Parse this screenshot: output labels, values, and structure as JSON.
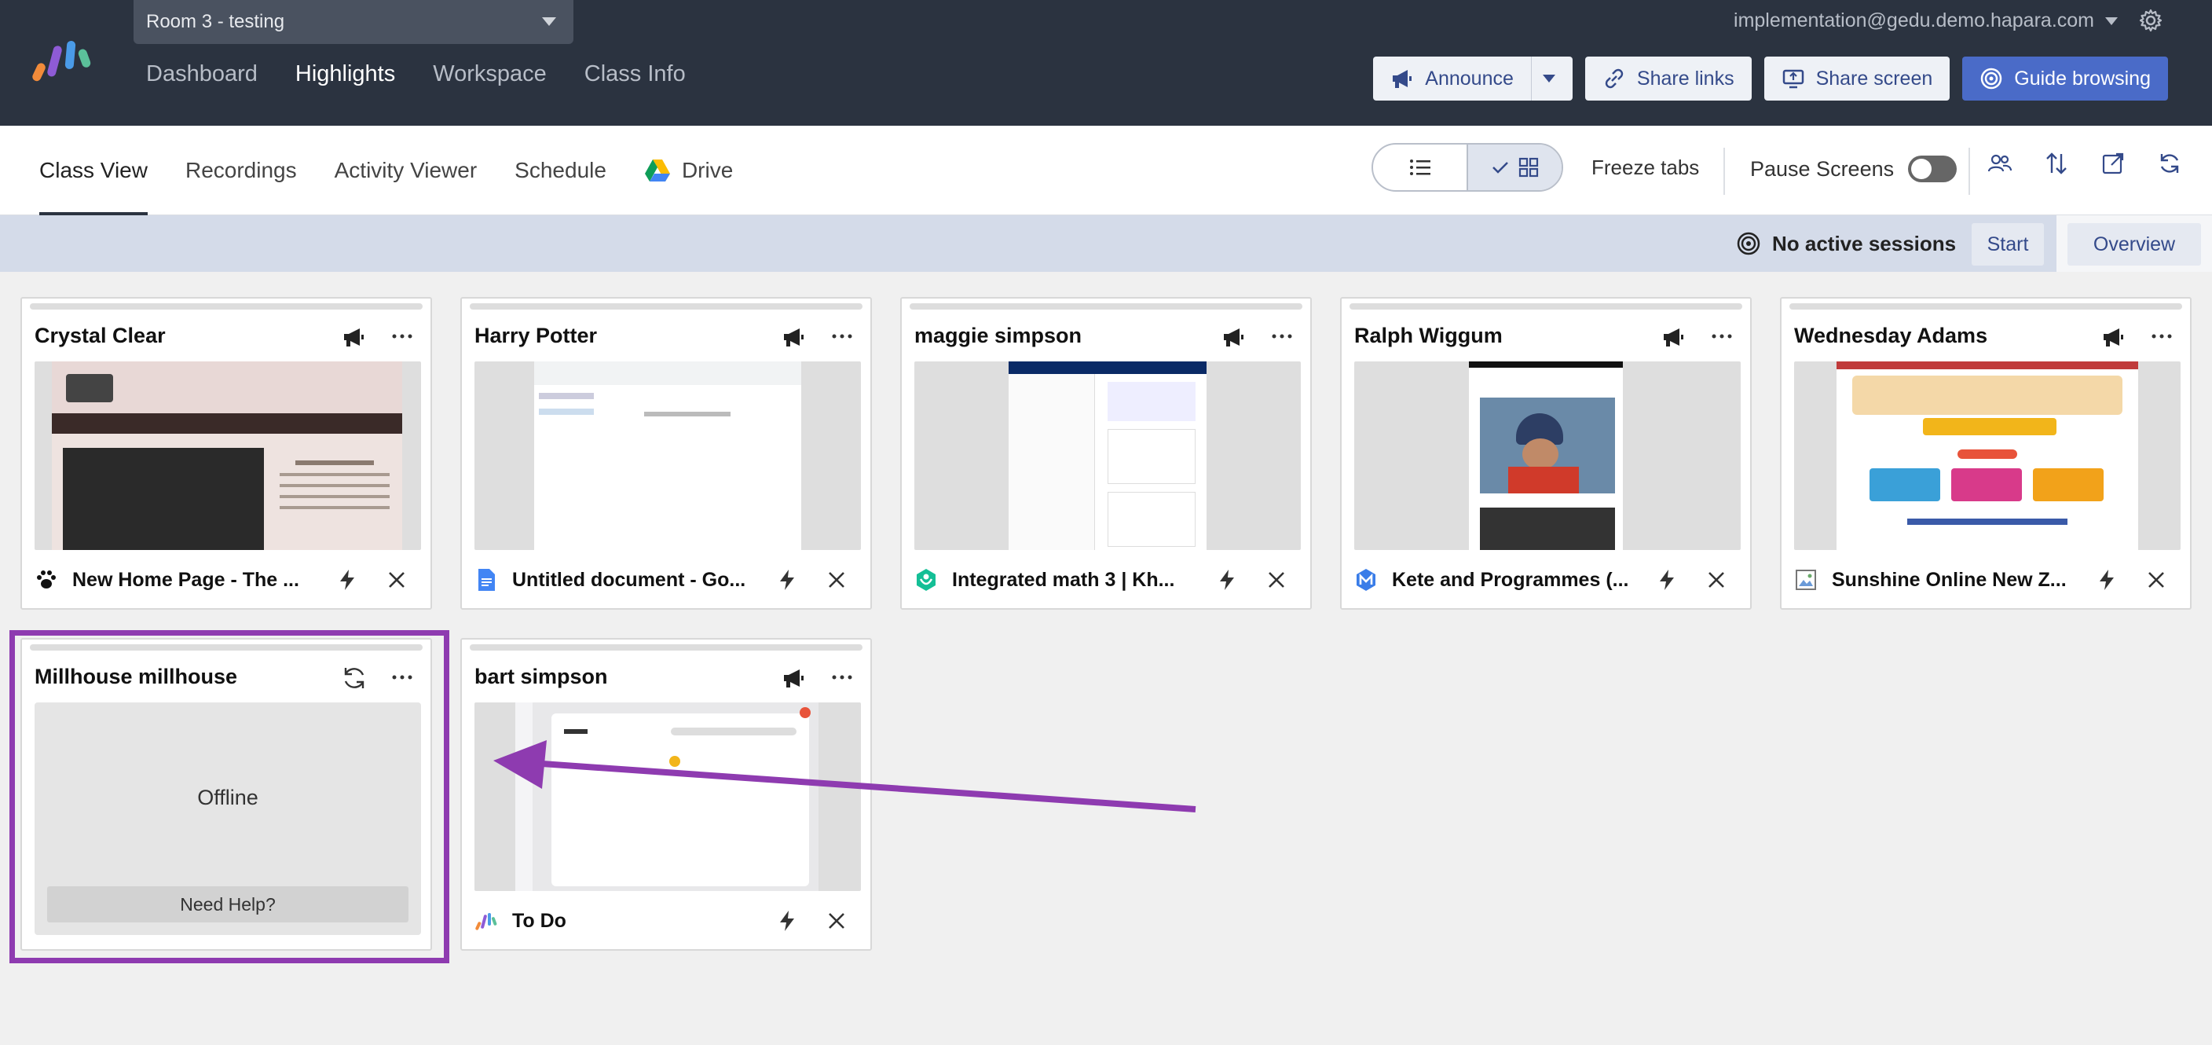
{
  "header": {
    "room": "Room 3 - testing",
    "nav": [
      "Dashboard",
      "Highlights",
      "Workspace",
      "Class Info"
    ],
    "active_nav": "Highlights",
    "account": "implementation@gedu.demo.hapara.com",
    "actions": {
      "announce": "Announce",
      "share_links": "Share links",
      "share_screen": "Share screen",
      "guide_browsing": "Guide browsing"
    }
  },
  "subnav": {
    "tabs": [
      "Class View",
      "Recordings",
      "Activity Viewer",
      "Schedule",
      "Drive"
    ],
    "freeze_tabs": "Freeze tabs",
    "pause_screens": "Pause Screens"
  },
  "session": {
    "status": "No active sessions",
    "start": "Start",
    "overview": "Overview"
  },
  "students": [
    {
      "name": "Crystal Clear",
      "tab_title": "New Home Page - The ...",
      "tab_icon": "paw-icon"
    },
    {
      "name": "Harry Potter",
      "tab_title": "Untitled document - Go...",
      "tab_icon": "google-docs-icon"
    },
    {
      "name": "maggie simpson",
      "tab_title": "Integrated math 3 | Kh...",
      "tab_icon": "khan-academy-icon"
    },
    {
      "name": "Ralph Wiggum",
      "tab_title": "Kete and Programmes (...",
      "tab_icon": "m-logo-icon"
    },
    {
      "name": "Wednesday Adams",
      "tab_title": "Sunshine Online New Z...",
      "tab_icon": "image-icon"
    },
    {
      "name": "Millhouse millhouse",
      "status": "Offline",
      "help": "Need Help?"
    },
    {
      "name": "bart simpson",
      "tab_title": "To Do",
      "tab_icon": "hapara-icon"
    }
  ],
  "colors": {
    "topbar": "#2b3340",
    "accent": "#4a6bc8",
    "highlight": "#8e3bb0",
    "session_bar": "#d4dbe9"
  }
}
